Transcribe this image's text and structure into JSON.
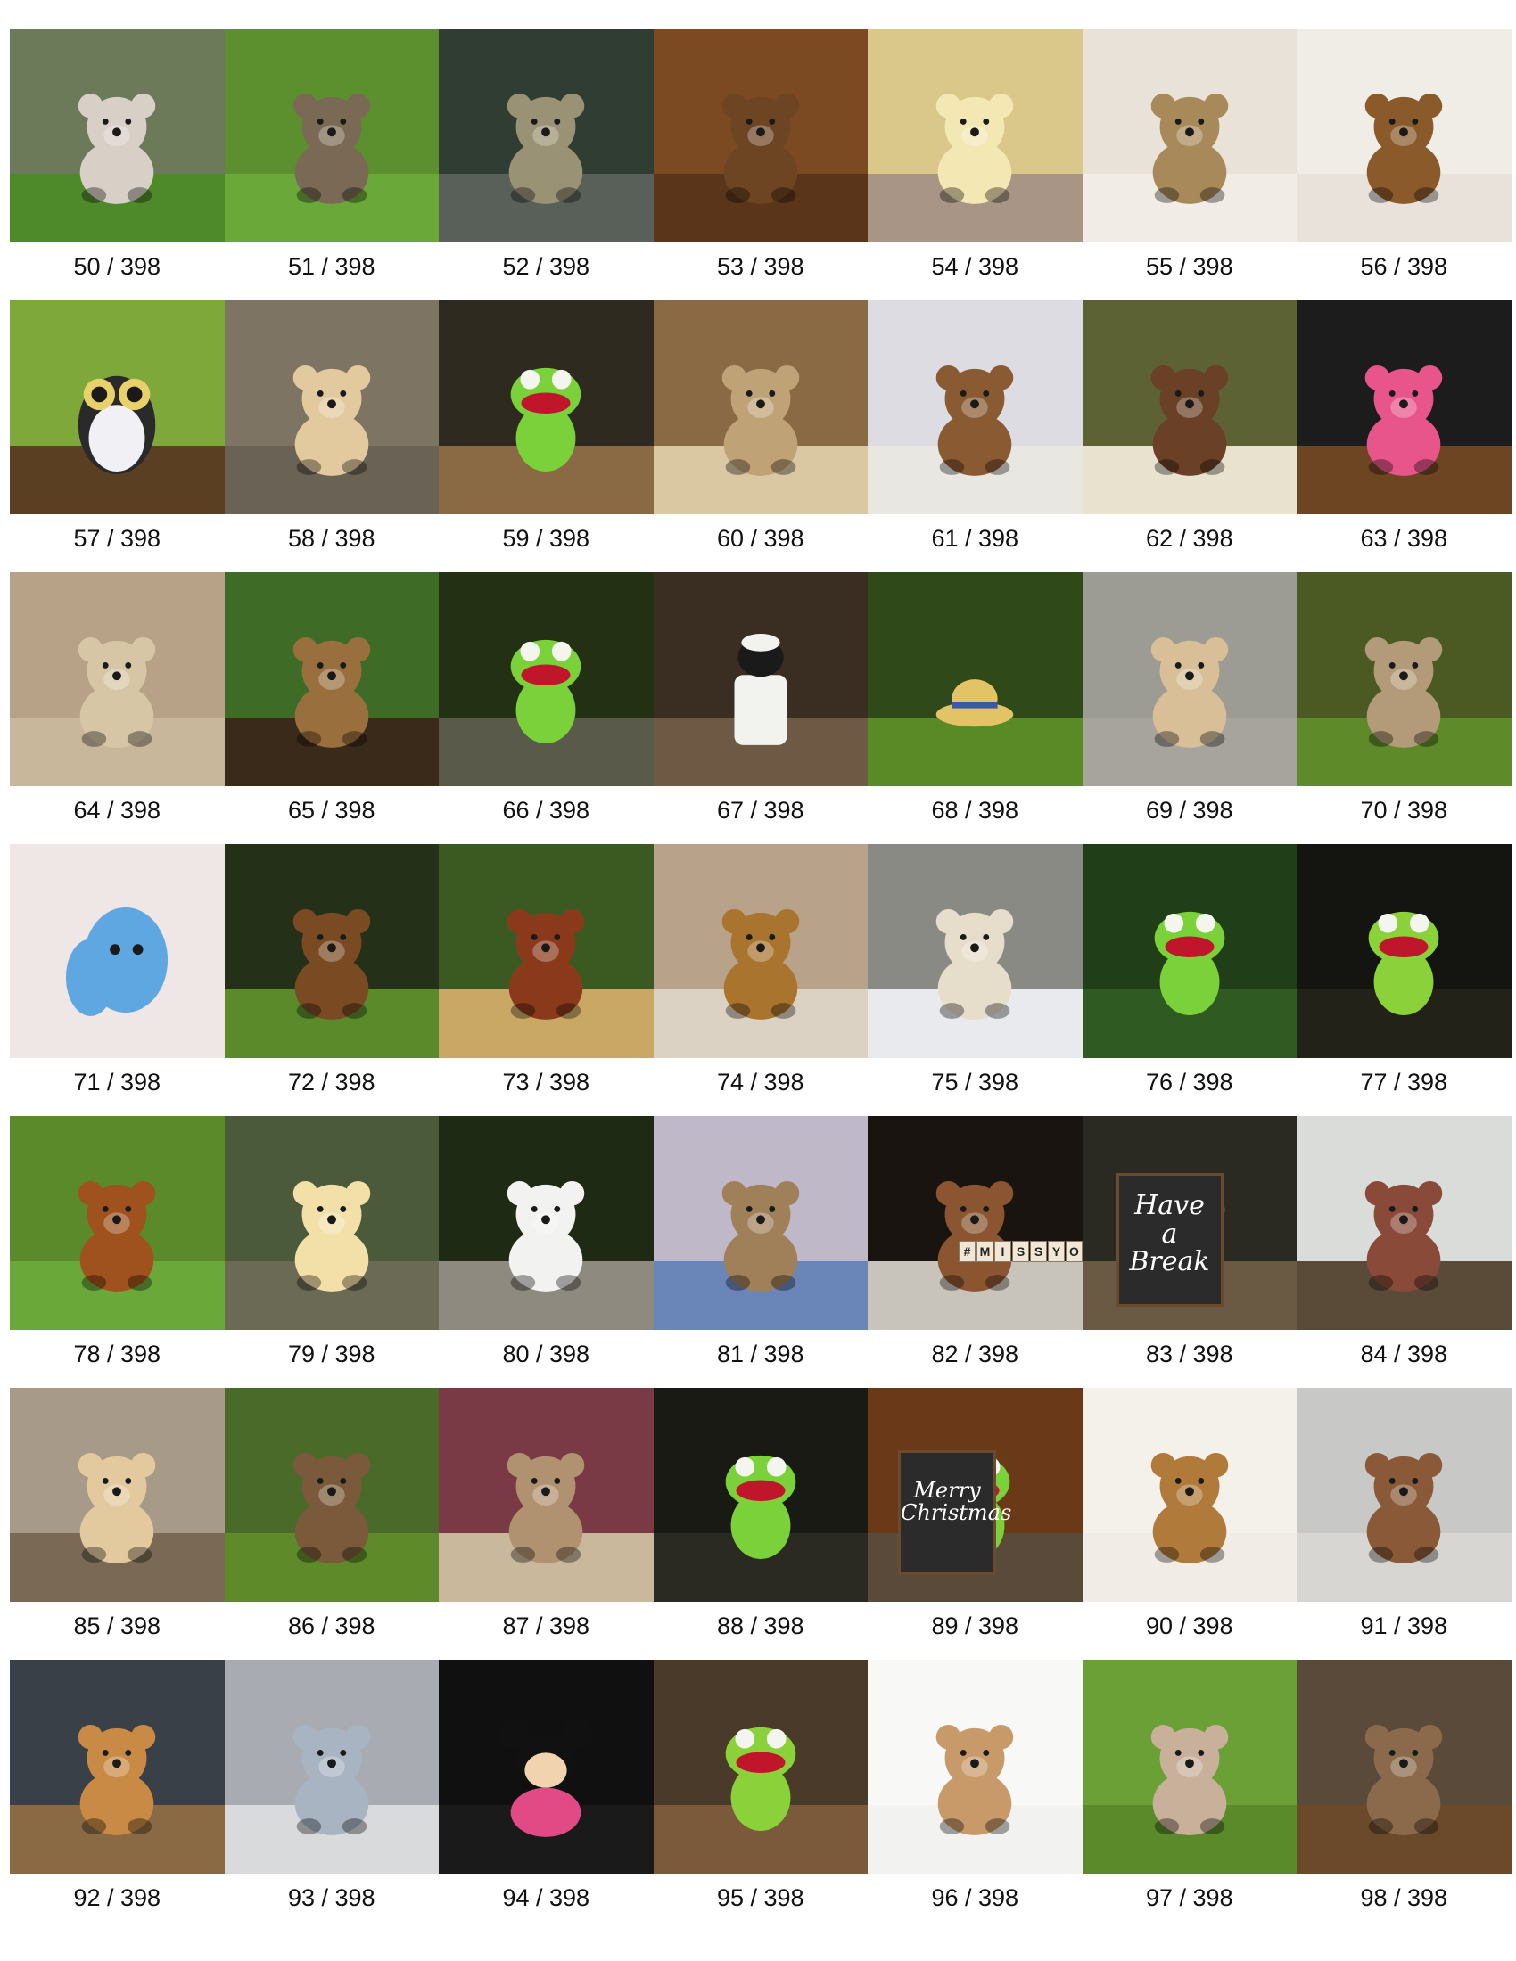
{
  "gallery": {
    "total": 398,
    "items": [
      {
        "caption": "50 / 398",
        "bg": "#6c7a5a",
        "ground": "#4f8a2a",
        "subject": "#d8cfc6",
        "shape": "bear"
      },
      {
        "caption": "51 / 398",
        "bg": "#5c8f2e",
        "ground": "#6aa83a",
        "subject": "#7a6a55",
        "shape": "bear"
      },
      {
        "caption": "52 / 398",
        "bg": "#2f3d33",
        "ground": "#59605a",
        "subject": "#9a9275",
        "shape": "bear"
      },
      {
        "caption": "53 / 398",
        "bg": "#7b4a22",
        "ground": "#5a351a",
        "subject": "#6e4523",
        "shape": "bear"
      },
      {
        "caption": "54 / 398",
        "bg": "#d9c88a",
        "ground": "#a89585",
        "subject": "#f3e7b4",
        "shape": "bear"
      },
      {
        "caption": "55 / 398",
        "bg": "#e8e2d8",
        "ground": "#f1ede6",
        "subject": "#a88a5a",
        "shape": "bear"
      },
      {
        "caption": "56 / 398",
        "bg": "#f0ece6",
        "ground": "#e8e2da",
        "subject": "#8a5a2a",
        "shape": "bear"
      },
      {
        "caption": "57 / 398",
        "bg": "#7fa83a",
        "ground": "#5a3f22",
        "subject": "#f1f1f5",
        "shape": "owl"
      },
      {
        "caption": "58 / 398",
        "bg": "#7d7464",
        "ground": "#6a6254",
        "subject": "#e2c99e",
        "shape": "bear"
      },
      {
        "caption": "59 / 398",
        "bg": "#2f2a20",
        "ground": "#8a6a45",
        "subject": "#7ad13a",
        "shape": "frog"
      },
      {
        "caption": "60 / 398",
        "bg": "#8a6a45",
        "ground": "#d9c8a2",
        "subject": "#c0a277",
        "shape": "bear"
      },
      {
        "caption": "61 / 398",
        "bg": "#dcdce2",
        "ground": "#e9e7e2",
        "subject": "#8a5a33",
        "shape": "bear"
      },
      {
        "caption": "62 / 398",
        "bg": "#5c6233",
        "ground": "#e8e2cf",
        "subject": "#6a4026",
        "shape": "bear"
      },
      {
        "caption": "63 / 398",
        "bg": "#1c1c1c",
        "ground": "#6e4523",
        "subject": "#e8558a",
        "shape": "bear"
      },
      {
        "caption": "64 / 398",
        "bg": "#b8a287",
        "ground": "#c9b79c",
        "subject": "#d6c6a6",
        "shape": "bear"
      },
      {
        "caption": "65 / 398",
        "bg": "#3e6b25",
        "ground": "#3a2a1a",
        "subject": "#9a6f3e",
        "shape": "bear"
      },
      {
        "caption": "66 / 398",
        "bg": "#243014",
        "ground": "#5a5a4a",
        "subject": "#7ad13a",
        "shape": "frog"
      },
      {
        "caption": "67 / 398",
        "bg": "#3a2e22",
        "ground": "#6e5a44",
        "subject": "#f2f2ee",
        "shape": "sheep"
      },
      {
        "caption": "68 / 398",
        "bg": "#2f4a18",
        "ground": "#5a8a25",
        "subject": "#e2c365",
        "shape": "hat"
      },
      {
        "caption": "69 / 398",
        "bg": "#9c9b94",
        "ground": "#a6a49c",
        "subject": "#d8bf98",
        "shape": "bear"
      },
      {
        "caption": "70 / 398",
        "bg": "#4a5a22",
        "ground": "#5e8a2a",
        "subject": "#b39a78",
        "shape": "bear"
      },
      {
        "caption": "71 / 398",
        "bg": "#efe6e6",
        "ground": "#efe6e6",
        "subject": "#5ea7e0",
        "shape": "blob"
      },
      {
        "caption": "72 / 398",
        "bg": "#243018",
        "ground": "#5a8a2a",
        "subject": "#7a4a22",
        "shape": "bear"
      },
      {
        "caption": "73 / 398",
        "bg": "#3a5a22",
        "ground": "#c9a866",
        "subject": "#8a3a1a",
        "shape": "bear"
      },
      {
        "caption": "74 / 398",
        "bg": "#b8a28a",
        "ground": "#dcd2c4",
        "subject": "#a8742e",
        "shape": "bear"
      },
      {
        "caption": "75 / 398",
        "bg": "#8a8a85",
        "ground": "#e8eaee",
        "subject": "#e6ddcb",
        "shape": "bear"
      },
      {
        "caption": "76 / 398",
        "bg": "#203f18",
        "ground": "#2f5a22",
        "subject": "#7ad13a",
        "shape": "frog"
      },
      {
        "caption": "77 / 398",
        "bg": "#141410",
        "ground": "#222218",
        "subject": "#8bd23a",
        "shape": "frog"
      },
      {
        "caption": "78 / 398",
        "bg": "#5a8a2a",
        "ground": "#6aa83a",
        "subject": "#a0521e",
        "shape": "bear"
      },
      {
        "caption": "79 / 398",
        "bg": "#4a5a3a",
        "ground": "#6a6a55",
        "subject": "#f3e0a8",
        "shape": "bear"
      },
      {
        "caption": "80 / 398",
        "bg": "#1e2a14",
        "ground": "#8e8a80",
        "subject": "#f2f2f0",
        "shape": "bear"
      },
      {
        "caption": "81 / 398",
        "bg": "#bfb8c8",
        "ground": "#6a86b8",
        "subject": "#a08058",
        "shape": "bear"
      },
      {
        "caption": "82 / 398",
        "bg": "#1a1410",
        "ground": "#c8c4bb",
        "subject": "#8a5530",
        "shape": "bear"
      },
      {
        "caption": "83 / 398",
        "bg": "#2a2a22",
        "ground": "#6a5a44",
        "subject": "#7ad13a",
        "shape": "frog"
      },
      {
        "caption": "84 / 398",
        "bg": "#d9dcd8",
        "ground": "#5a4a38",
        "subject": "#8a4a3a",
        "shape": "bear"
      },
      {
        "caption": "85 / 398",
        "bg": "#a89a88",
        "ground": "#7a6a55",
        "subject": "#e2c99e",
        "shape": "bear"
      },
      {
        "caption": "86 / 398",
        "bg": "#4a6a2a",
        "ground": "#5e8a2a",
        "subject": "#7a5a3a",
        "shape": "bear"
      },
      {
        "caption": "87 / 398",
        "bg": "#7a3a45",
        "ground": "#c9b89c",
        "subject": "#b09270",
        "shape": "bear"
      },
      {
        "caption": "88 / 398",
        "bg": "#1a1a14",
        "ground": "#2a2a22",
        "subject": "#7ad13a",
        "shape": "frog"
      },
      {
        "caption": "89 / 398",
        "bg": "#6a3a18",
        "ground": "#5a4a3a",
        "subject": "#7ad13a",
        "shape": "frog"
      },
      {
        "caption": "90 / 398",
        "bg": "#f4f0ea",
        "ground": "#f1ede6",
        "subject": "#b07a3a",
        "shape": "bear"
      },
      {
        "caption": "91 / 398",
        "bg": "#c8c8c6",
        "ground": "#d8d6d2",
        "subject": "#8a5a38",
        "shape": "bear"
      },
      {
        "caption": "92 / 398",
        "bg": "#3a4048",
        "ground": "#8a6a45",
        "subject": "#c98a45",
        "shape": "bear"
      },
      {
        "caption": "93 / 398",
        "bg": "#a8acb2",
        "ground": "#d8dadc",
        "subject": "#a8b4c2",
        "shape": "bear"
      },
      {
        "caption": "94 / 398",
        "bg": "#101010",
        "ground": "#1a1a1a",
        "subject": "#e24a85",
        "shape": "mouse"
      },
      {
        "caption": "95 / 398",
        "bg": "#4a3a2a",
        "ground": "#7a5a3a",
        "subject": "#8bd23a",
        "shape": "frog"
      },
      {
        "caption": "96 / 398",
        "bg": "#f8f8f6",
        "ground": "#f2f2f0",
        "subject": "#c89a6a",
        "shape": "bear"
      },
      {
        "caption": "97 / 398",
        "bg": "#6aa035",
        "ground": "#5a8a2a",
        "subject": "#c8b09a",
        "shape": "bear"
      },
      {
        "caption": "98 / 398",
        "bg": "#5a4a3a",
        "ground": "#6a4a2a",
        "subject": "#8a6a4a",
        "shape": "bear"
      }
    ]
  },
  "overlays": {
    "sign_83": "Have\na\nBreak",
    "sign_89": "Merry\nChristmas",
    "tiles_82": [
      "#",
      "M",
      "I",
      "S",
      "S",
      "Y",
      "O"
    ]
  }
}
